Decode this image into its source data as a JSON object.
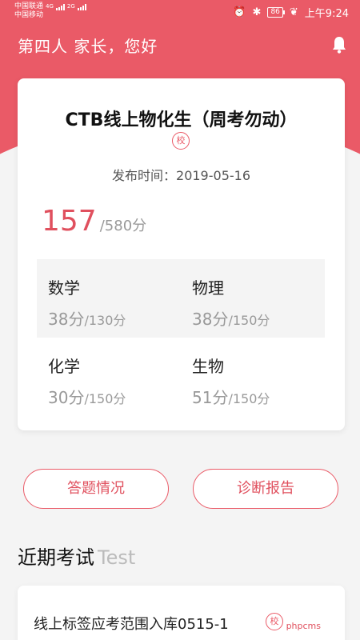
{
  "status_bar": {
    "carrier_1": "中国联通",
    "carrier_1_net": "4G",
    "carrier_2": "中国移动",
    "carrier_2_net": "2G",
    "battery": "86",
    "time": "上午9:24"
  },
  "header": {
    "greeting": "第四人 家长，您好"
  },
  "exam": {
    "title": "CTB线上物化生（周考勿动）",
    "school_badge": "校",
    "publish_label": "发布时间：",
    "publish_date": "2019-05-16",
    "total_score": "157",
    "total_max": "/580分"
  },
  "subjects": [
    {
      "name": "数学",
      "score": "38分",
      "max": "/130分"
    },
    {
      "name": "物理",
      "score": "38分",
      "max": "/150分"
    },
    {
      "name": "化学",
      "score": "30分",
      "max": "/150分"
    },
    {
      "name": "生物",
      "score": "51分",
      "max": "/150分"
    }
  ],
  "buttons": {
    "answers": "答题情况",
    "report": "诊断报告"
  },
  "recent": {
    "title_cn": "近期考试",
    "title_en": "Test",
    "items": [
      {
        "title": "线上标签应考范围入库0515-1",
        "badge": "校"
      }
    ]
  },
  "watermark": "phpcms",
  "colors": {
    "accent": "#ea5a67",
    "score_red": "#e0505e",
    "background": "#f4f4f4"
  }
}
